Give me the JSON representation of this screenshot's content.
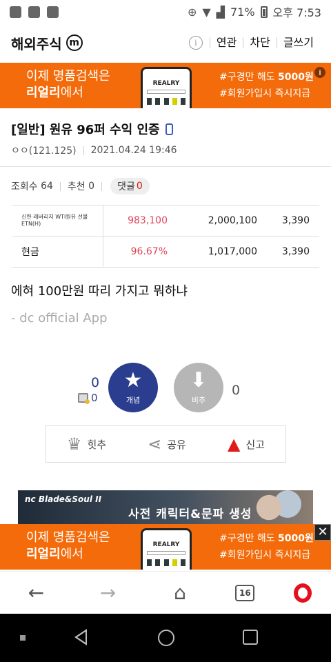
{
  "status_bar": {
    "battery": "71%",
    "time": "오후 7:53"
  },
  "header": {
    "gallery_name": "해외주식",
    "gallery_badge": "m",
    "links": [
      "연관",
      "차단",
      "글쓰기"
    ]
  },
  "ad_banner": {
    "line1": "이제 명품검색은",
    "line2_bold": "리얼리",
    "line2_rest": "에서",
    "phone_brand": "REALRY",
    "right_line1_prefix": "#구경만 해도 ",
    "right_line1_bold": "5000원",
    "right_line2": "#회원가입시 즉시지급",
    "info": "i",
    "close": "✕"
  },
  "post": {
    "title": "[일반] 원유 96퍼 수익 인증",
    "author": "ㅇㅇ(121.125)",
    "date": "2021.04.24 19:46",
    "views_label": "조회수",
    "views": "64",
    "recommend_label": "추천",
    "recommend": "0",
    "reply_label": "댓글",
    "reply": "0",
    "body": "에혀 100만원 따리 가지고 뭐하냐",
    "signature": "- dc official App"
  },
  "holdings": [
    {
      "name": "신한 레버리지 WTI원유 선물 ETN(H)",
      "rate": "983,100",
      "amount": "2,000,100",
      "qty": "3,390"
    },
    {
      "name": "현금",
      "rate": "96.67%",
      "amount": "1,017,000",
      "qty": "3,390"
    }
  ],
  "recommend_box": {
    "up_count": "0",
    "fixed_count": "0",
    "up_label": "개념",
    "down_label": "비추",
    "down_count": "0"
  },
  "actions": {
    "hit": "힛추",
    "share": "공유",
    "report": "신고"
  },
  "image_ad": {
    "logo": "nc  Blade&Soul II",
    "text": "사전 캐릭터&문파 생성"
  },
  "browser": {
    "tabs": "16"
  }
}
